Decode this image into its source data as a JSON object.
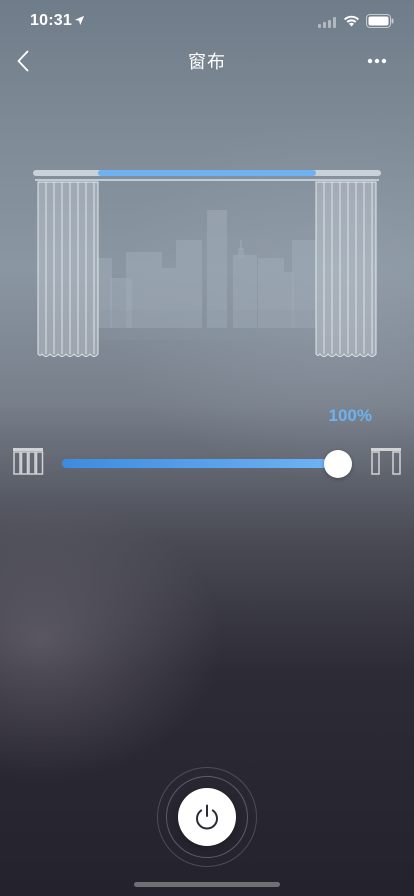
{
  "status_bar": {
    "time": "10:31",
    "icons": [
      "location-arrow-icon",
      "cellular-signal-icon",
      "wifi-icon",
      "battery-icon"
    ]
  },
  "nav": {
    "title": "窗布",
    "back_icon": "chevron-left-icon",
    "more_icon": "ellipsis-icon"
  },
  "curtain": {
    "open_fraction": 1.0,
    "rail_color": "#c9d1d9",
    "rail_highlight_color": "#6fb2f2",
    "curtain_color": "#d7dde3"
  },
  "slider": {
    "value_label": "100%",
    "value": 100,
    "min": 0,
    "max": 100,
    "accent_color": "#4a9be8",
    "left_icon": "curtain-closed-icon",
    "right_icon": "curtain-open-icon"
  },
  "power": {
    "icon": "power-icon",
    "state": "on"
  }
}
